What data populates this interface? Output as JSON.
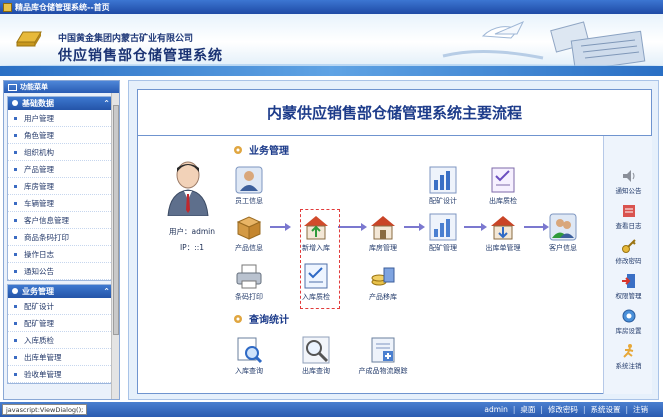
{
  "window": {
    "title": "精品库仓储管理系统--首页"
  },
  "banner": {
    "company": "中国黄金集团内蒙古矿业有限公司",
    "system": "供应销售部仓储管理系统"
  },
  "sidebar": {
    "header": "功能菜单",
    "groups": [
      {
        "title": "基础数据",
        "items": [
          "用户管理",
          "角色管理",
          "组织机构",
          "产品管理",
          "库房管理",
          "车辆管理",
          "客户信息管理",
          "商品条码打印",
          "操作日志",
          "通知公告"
        ]
      },
      {
        "title": "业务管理",
        "items": [
          "配矿设计",
          "配矿管理",
          "入库质检",
          "出库单管理",
          "验收单管理"
        ]
      }
    ]
  },
  "main": {
    "title": "内蒙供应销售部仓储管理系统主要流程",
    "user": {
      "name": "用户：admin",
      "ip": "IP：::1"
    },
    "sections": {
      "business": "业务管理",
      "query": "查询统计"
    },
    "nodes": {
      "staff": "员工信息",
      "product": "产品信息",
      "barcode": "条码打印",
      "new_in": "新增入库",
      "in_qc": "入库质检",
      "warehouse": "库房管理",
      "product_move": "产品移库",
      "ore_design": "配矿设计",
      "ore_manage": "配矿管理",
      "out_qc": "出库质检",
      "out_manage": "出库单管理",
      "customer": "客户信息",
      "in_query": "入库查询",
      "out_query": "出库查询",
      "trace": "产成品物流跟踪"
    },
    "quick": [
      "通知公告",
      "查看日志",
      "修改密码",
      "权限管理",
      "库房设置",
      "系统注销"
    ]
  },
  "status": {
    "url": "javascript:ViewDialog();",
    "links": [
      "admin",
      "桌面",
      "修改密码",
      "系统设置",
      "注销"
    ]
  }
}
